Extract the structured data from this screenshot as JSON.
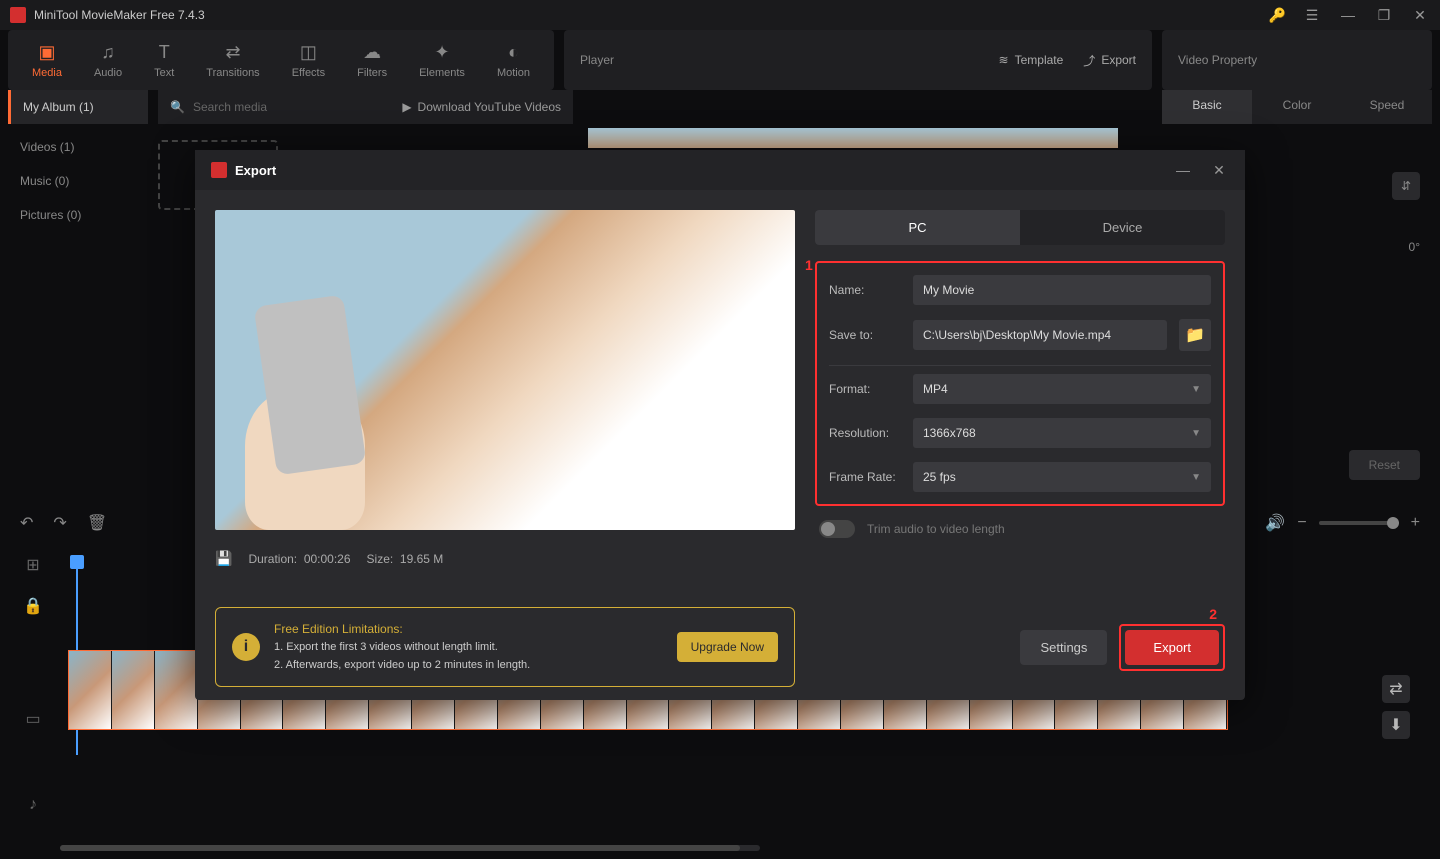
{
  "titleBar": {
    "appName": "MiniTool MovieMaker Free 7.4.3"
  },
  "toolbar": {
    "media": "Media",
    "audio": "Audio",
    "text": "Text",
    "transitions": "Transitions",
    "effects": "Effects",
    "filters": "Filters",
    "elements": "Elements",
    "motion": "Motion"
  },
  "playerPanel": {
    "label": "Player",
    "template": "Template",
    "export": "Export"
  },
  "propPanel": {
    "title": "Video Property",
    "tabs": {
      "basic": "Basic",
      "color": "Color",
      "speed": "Speed"
    },
    "rotate": "0°",
    "reset": "Reset"
  },
  "secondaryBar": {
    "album": "My Album (1)",
    "searchPlaceholder": "Search media",
    "download": "Download YouTube Videos"
  },
  "sidebar": {
    "videos": "Videos (1)",
    "music": "Music (0)",
    "pictures": "Pictures (0)"
  },
  "exportModal": {
    "title": "Export",
    "tabs": {
      "pc": "PC",
      "device": "Device"
    },
    "annotations": {
      "one": "1",
      "two": "2"
    },
    "fields": {
      "nameLabel": "Name:",
      "nameValue": "My Movie",
      "saveLabel": "Save to:",
      "saveValue": "C:\\Users\\bj\\Desktop\\My Movie.mp4",
      "formatLabel": "Format:",
      "formatValue": "MP4",
      "resolutionLabel": "Resolution:",
      "resolutionValue": "1366x768",
      "frameRateLabel": "Frame Rate:",
      "frameRateValue": "25 fps"
    },
    "trimLabel": "Trim audio to video length",
    "info": {
      "durationLabel": "Duration:",
      "durationValue": "00:00:26",
      "sizeLabel": "Size:",
      "sizeValue": "19.65 M"
    },
    "limitations": {
      "title": "Free Edition Limitations:",
      "line1": "1. Export the first 3 videos without length limit.",
      "line2": "2. Afterwards, export video up to 2 minutes in length.",
      "upgrade": "Upgrade Now"
    },
    "buttons": {
      "settings": "Settings",
      "export": "Export"
    }
  }
}
